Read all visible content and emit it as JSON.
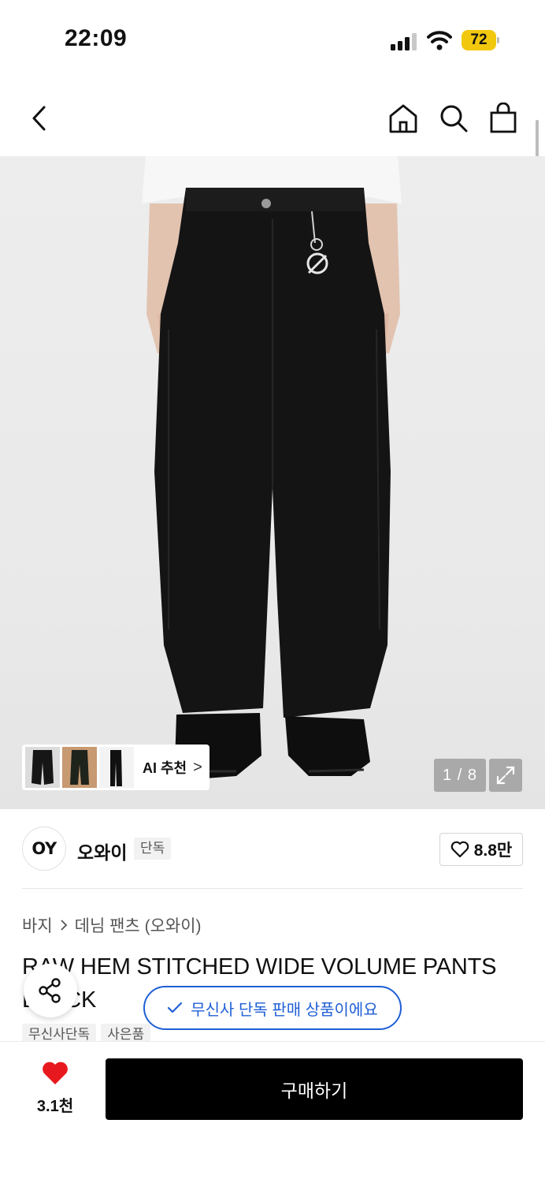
{
  "status": {
    "time": "22:09",
    "battery": "72",
    "battery_color": "#f2c80f"
  },
  "nav": {
    "back_icon": "chevron-left-icon",
    "home_icon": "home-icon",
    "search_icon": "search-icon",
    "bag_icon": "shopping-bag-icon"
  },
  "gallery": {
    "ai_recommend_label": "AI 추천",
    "ai_recommend_chevron": ">",
    "page_counter": "1 / 8",
    "expand_icon": "expand-icon"
  },
  "brand": {
    "logo_text": "OY",
    "name": "오와이",
    "badge": "단독",
    "like_count": "8.8만"
  },
  "product": {
    "breadcrumb": [
      "바지",
      "데님 팬츠 (오와이)"
    ],
    "title": "RAW HEM STITCHED WIDE VOLUME PANTS BLACK",
    "tags": [
      "무신사단독",
      "사은품"
    ]
  },
  "exclusive_notice": "무신사 단독 판매 상품이에요",
  "accent_color": "#1f5fd6",
  "bottom": {
    "heart_count": "3.1천",
    "heart_color": "#e8191e",
    "buy_label": "구매하기"
  }
}
